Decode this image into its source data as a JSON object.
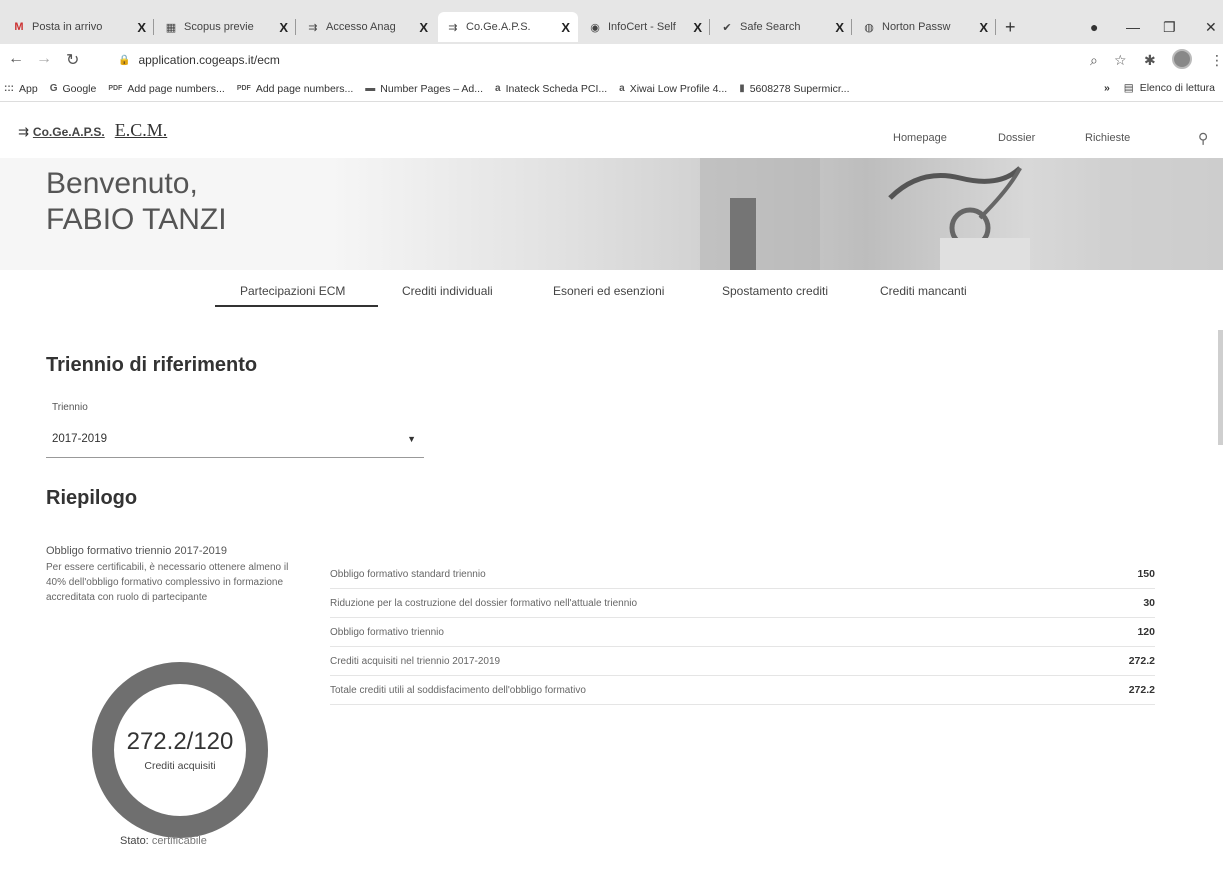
{
  "browser": {
    "tabs": [
      {
        "icon": "M",
        "title": "Posta in arrivo"
      },
      {
        "icon": "▦",
        "title": "Scopus previe"
      },
      {
        "icon": "⇉",
        "title": "Accesso Anag"
      },
      {
        "icon": "⇉",
        "title": "Co.Ge.A.P.S."
      },
      {
        "icon": "◉",
        "title": "InfoCert - Self"
      },
      {
        "icon": "✔",
        "title": "Safe Search"
      },
      {
        "icon": "◍",
        "title": "Norton Passw"
      }
    ],
    "close_glyph": "X",
    "new_tab_glyph": "+",
    "url": "application.cogeaps.it/ecm",
    "bookmarks": [
      {
        "icon": ":::",
        "label": "App"
      },
      {
        "icon": "G",
        "label": "Google"
      },
      {
        "icon": "PDF",
        "label": "Add page numbers..."
      },
      {
        "icon": "PDF",
        "label": "Add page numbers..."
      },
      {
        "icon": "▬",
        "label": "Number Pages – Ad..."
      },
      {
        "icon": "a",
        "label": "Inateck Scheda PCI..."
      },
      {
        "icon": "a",
        "label": "Xiwai Low Profile 4..."
      },
      {
        "icon": "▮",
        "label": "5608278 Supermicr..."
      }
    ],
    "bookmarks_more": "»",
    "reading_list": "Elenco di lettura"
  },
  "site": {
    "logo_small": "Co.Ge.A.P.S.",
    "logo_big": "E.C.M.",
    "nav": [
      "Homepage",
      "Dossier",
      "Richieste"
    ]
  },
  "hero": {
    "greeting": "Benvenuto,",
    "name": "FABIO TANZI"
  },
  "subtabs": [
    "Partecipazioni ECM",
    "Crediti individuali",
    "Esoneri ed esenzioni",
    "Spostamento crediti",
    "Crediti mancanti"
  ],
  "triennio": {
    "heading": "Triennio di riferimento",
    "label": "Triennio",
    "value": "2017-2019"
  },
  "riepilogo": {
    "heading": "Riepilogo",
    "obbligo_title": "Obbligo formativo triennio 2017-2019",
    "obbligo_text": "Per essere certificabili, è necessario ottenere almeno il 40% dell'obbligo formativo complessivo in formazione accreditata con ruolo di partecipante",
    "donut_value": "272.2/120",
    "donut_label": "Crediti acquisiti",
    "donut_fill_fraction": 1.0,
    "stato_label": "Stato:",
    "stato_value": "certificabile",
    "rows": [
      {
        "label": "Obbligo formativo standard triennio",
        "value": "150"
      },
      {
        "label": "Riduzione per la costruzione del dossier formativo nell'attuale triennio",
        "value": "30"
      },
      {
        "label": "Obbligo formativo triennio",
        "value": "120"
      },
      {
        "label": "Crediti acquisiti nel triennio 2017-2019",
        "value": "272.2"
      },
      {
        "label": "Totale crediti utili al soddisfacimento dell'obbligo formativo",
        "value": "272.2"
      }
    ]
  },
  "colors": {
    "donut": "#6f6f6f",
    "text": "#333333"
  }
}
